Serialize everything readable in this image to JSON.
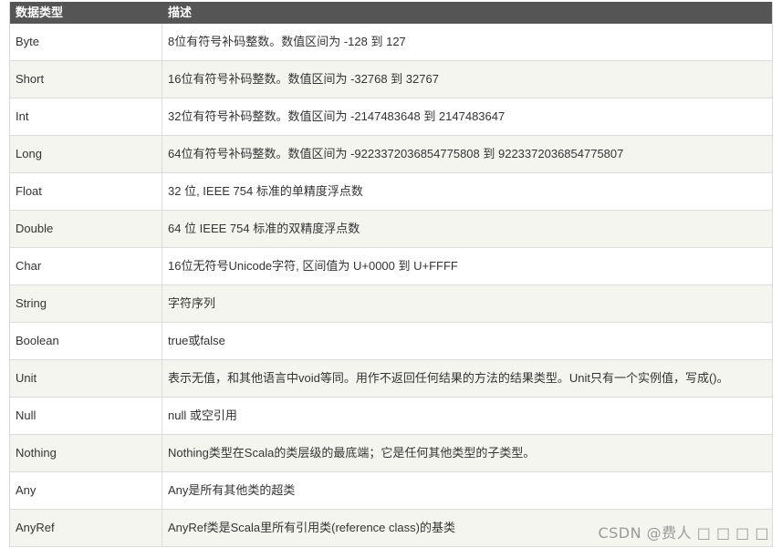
{
  "table": {
    "headers": [
      "数据类型",
      "描述"
    ],
    "rows": [
      {
        "type": "Byte",
        "desc": "8位有符号补码整数。数值区间为 -128 到 127"
      },
      {
        "type": "Short",
        "desc": "16位有符号补码整数。数值区间为 -32768 到 32767"
      },
      {
        "type": "Int",
        "desc": "32位有符号补码整数。数值区间为 -2147483648 到 2147483647"
      },
      {
        "type": "Long",
        "desc": "64位有符号补码整数。数值区间为 -9223372036854775808 到 9223372036854775807"
      },
      {
        "type": "Float",
        "desc": "32 位, IEEE 754 标准的单精度浮点数"
      },
      {
        "type": "Double",
        "desc": "64 位 IEEE 754 标准的双精度浮点数"
      },
      {
        "type": "Char",
        "desc": "16位无符号Unicode字符, 区间值为 U+0000 到 U+FFFF"
      },
      {
        "type": "String",
        "desc": "字符序列"
      },
      {
        "type": "Boolean",
        "desc": "true或false"
      },
      {
        "type": "Unit",
        "desc": "表示无值，和其他语言中void等同。用作不返回任何结果的方法的结果类型。Unit只有一个实例值，写成()。"
      },
      {
        "type": "Null",
        "desc": "null 或空引用"
      },
      {
        "type": "Nothing",
        "desc": "Nothing类型在Scala的类层级的最底端；它是任何其他类型的子类型。"
      },
      {
        "type": "Any",
        "desc": "Any是所有其他类的超类"
      },
      {
        "type": "AnyRef",
        "desc": "AnyRef类是Scala里所有引用类(reference class)的基类"
      }
    ]
  },
  "watermark": "CSDN @费人 □ □ □ □"
}
